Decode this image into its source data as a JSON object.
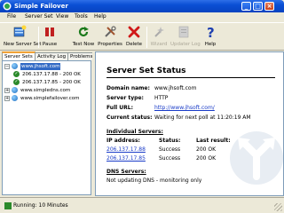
{
  "window": {
    "title": "Simple Failover"
  },
  "menu": {
    "items": [
      "File",
      "Server Set",
      "View",
      "Tools",
      "Help"
    ]
  },
  "toolbar": {
    "new_server_set": "New Server Set",
    "pause": "Pause",
    "test_now": "Test Now",
    "properties": "Properties",
    "delete": "Delete",
    "wizard": "Wizard",
    "updater_log": "Updater Log",
    "help": "Help"
  },
  "tabs": [
    "Server Sets",
    "Activity Log",
    "Problems"
  ],
  "tree": {
    "sets": [
      {
        "name": "www.jhsoft.com",
        "servers": [
          "206.137.17.88 - 200 OK",
          "206.137.17.85 - 200 OK"
        ]
      },
      {
        "name": "www.simpledns.com"
      },
      {
        "name": "www.simplefailover.com"
      }
    ]
  },
  "details": {
    "heading": "Server Set Status",
    "domain_label": "Domain name:",
    "domain_value": "www.jhsoft.com",
    "type_label": "Server type:",
    "type_value": "HTTP",
    "url_label": "Full URL:",
    "url_value": "http://www.jhsoft.com/",
    "status_label": "Current status:",
    "status_value": "Waiting for next poll at 11:20:19 AM",
    "individual_heading": "Individual Servers:",
    "columns": [
      "IP address:",
      "Status:",
      "Last result:"
    ],
    "rows": [
      {
        "ip": "206.137.17.88",
        "status": "Success",
        "result": "200 OK"
      },
      {
        "ip": "206.137.17.85",
        "status": "Success",
        "result": "200 OK"
      }
    ],
    "dns_heading": "DNS Servers:",
    "dns_text": "Not updating DNS - monitoring only"
  },
  "statusbar": {
    "text": "Running: 10 Minutes"
  },
  "colors": {
    "titlebar": "#0a4fd4",
    "link": "#1a3cc8",
    "selection": "#316ac5",
    "ok": "#2b8a2b"
  }
}
